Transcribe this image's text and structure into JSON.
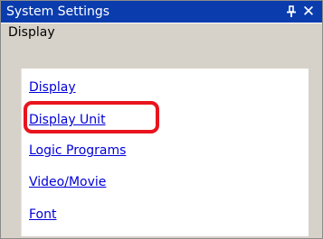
{
  "window": {
    "title": "System Settings",
    "pin_glyph": "p",
    "close_glyph": "✕"
  },
  "panel": {
    "section_title": "Display",
    "links": [
      {
        "label": "Display"
      },
      {
        "label": "Display Unit"
      },
      {
        "label": "Logic Programs"
      },
      {
        "label": "Video/Movie"
      },
      {
        "label": "Font"
      }
    ]
  },
  "colors": {
    "titlebar": "#0a3cae",
    "panel": "#d7d2c9",
    "link": "#0000d9",
    "highlight": "#e8141e"
  },
  "icons": {
    "pin": "pin-icon",
    "close": "close-icon"
  }
}
